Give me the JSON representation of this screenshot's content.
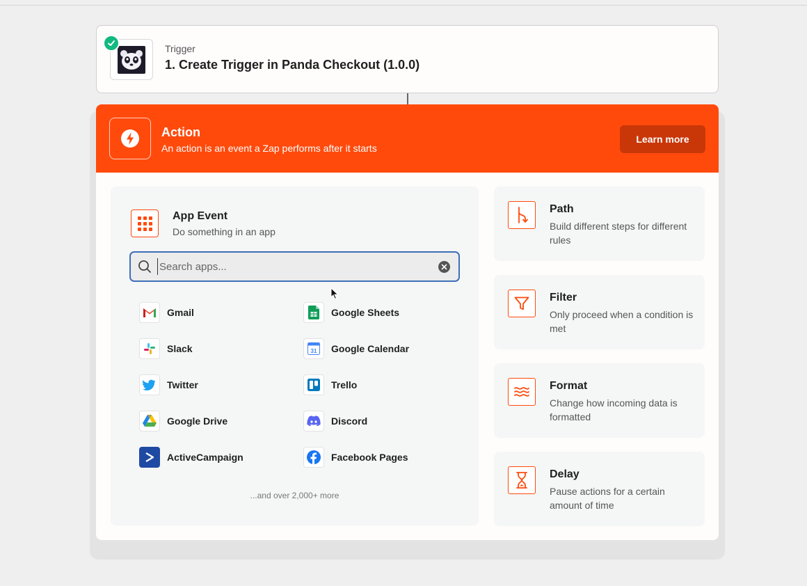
{
  "trigger": {
    "kicker": "Trigger",
    "title": "1. Create Trigger in Panda Checkout (1.0.0)",
    "icon": "panda-logo",
    "status_icon": "check-icon",
    "status_color": "#12b981"
  },
  "action": {
    "title": "Action",
    "subtitle": "An action is an event a Zap performs after it starts",
    "learn_more_label": "Learn more",
    "accent_color": "#ff4a0c",
    "icon": "lightning-icon"
  },
  "app_event": {
    "title": "App Event",
    "subtitle": "Do something in an app",
    "icon": "grid-icon",
    "search": {
      "placeholder": "Search apps...",
      "value": ""
    },
    "apps_left": [
      {
        "name": "Gmail",
        "icon": "gmail-icon"
      },
      {
        "name": "Slack",
        "icon": "slack-icon"
      },
      {
        "name": "Twitter",
        "icon": "twitter-icon"
      },
      {
        "name": "Google Drive",
        "icon": "google-drive-icon"
      },
      {
        "name": "ActiveCampaign",
        "icon": "activecampaign-icon"
      }
    ],
    "apps_right": [
      {
        "name": "Google Sheets",
        "icon": "google-sheets-icon"
      },
      {
        "name": "Google Calendar",
        "icon": "google-calendar-icon"
      },
      {
        "name": "Trello",
        "icon": "trello-icon"
      },
      {
        "name": "Discord",
        "icon": "discord-icon"
      },
      {
        "name": "Facebook Pages",
        "icon": "facebook-icon"
      }
    ],
    "more_text": "...and over 2,000+ more"
  },
  "tools": [
    {
      "title": "Path",
      "description": "Build different steps for different rules",
      "icon": "path-icon"
    },
    {
      "title": "Filter",
      "description": "Only proceed when a condition is met",
      "icon": "filter-icon"
    },
    {
      "title": "Format",
      "description": "Change how incoming data is formatted",
      "icon": "format-icon"
    },
    {
      "title": "Delay",
      "description": "Pause actions for a certain amount of time",
      "icon": "hourglass-icon"
    }
  ]
}
